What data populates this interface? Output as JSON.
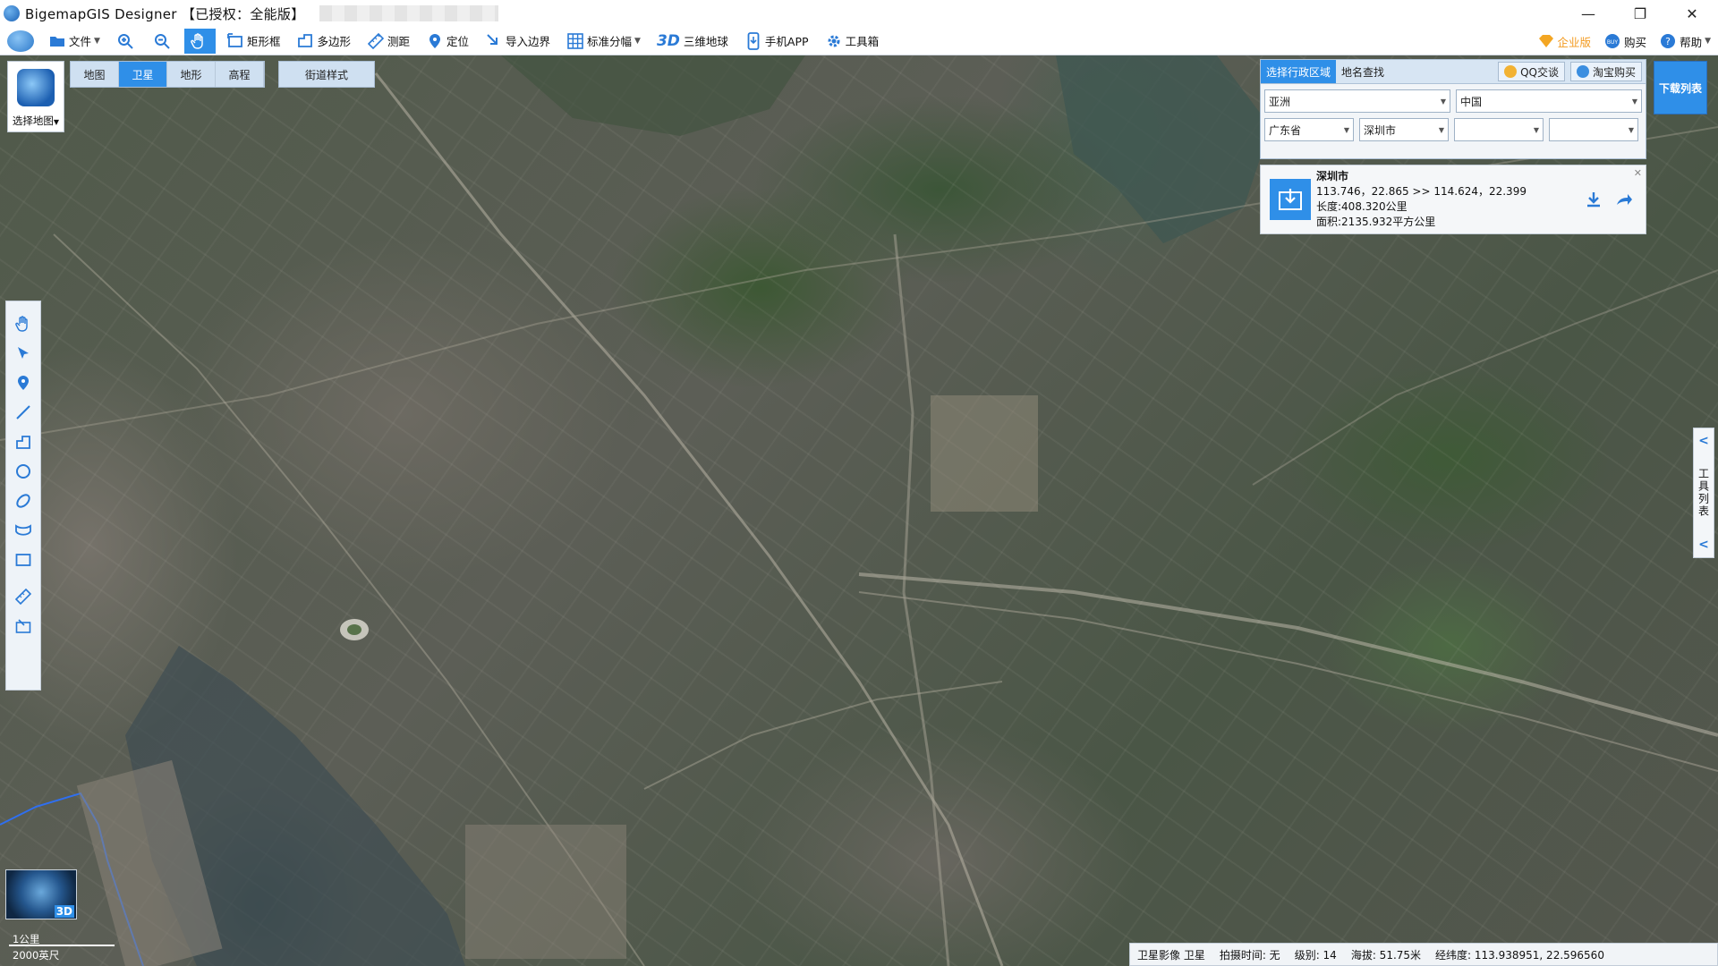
{
  "window": {
    "title": "BigemapGIS Designer 【已授权：全能版】",
    "controls": [
      "—",
      "❐",
      "✕"
    ]
  },
  "toolbar": {
    "file": "文件",
    "zoom_in": "",
    "zoom_out": "",
    "pan": "",
    "rect": "矩形框",
    "polygon": "多边形",
    "measure": "测距",
    "locate": "定位",
    "import_boundary": "导入边界",
    "standard_sheet": "标准分幅",
    "three_d_mark": "3D",
    "globe": "三维地球",
    "mobile": "手机APP",
    "toolbox": "工具箱",
    "enterprise": "企业版",
    "buy": "购买",
    "help": "帮助"
  },
  "map_switch": {
    "select_map": "选择地图",
    "tabs": [
      "地图",
      "卫星",
      "地形",
      "高程"
    ],
    "active_tab": "卫星",
    "street_style": "街道样式"
  },
  "region_panel": {
    "tab_admin": "选择行政区域",
    "tab_search": "地名查找",
    "qq_btn": "QQ交谈",
    "taobao_btn": "淘宝购买",
    "continent": "亚洲",
    "country": "中国",
    "province": "广东省",
    "city": "深圳市",
    "district": "",
    "town": ""
  },
  "result": {
    "city": "深圳市",
    "coords": "113.746，22.865 >> 114.624，22.399",
    "length": "长度:408.320公里",
    "area": "面积:2135.932平方公里"
  },
  "download_list": "下载列表",
  "side_tools": "工具列表",
  "globe3d_label": "3D",
  "scale": {
    "metric": "1公里",
    "imperial": "2000英尺"
  },
  "status": {
    "source": "卫星影像 卫星",
    "capture_time": "拍摄时间: 无",
    "level": "级别:  14",
    "altitude": "海拔: 51.75米",
    "lonlat": "经纬度:  113.938951, 22.596560"
  }
}
